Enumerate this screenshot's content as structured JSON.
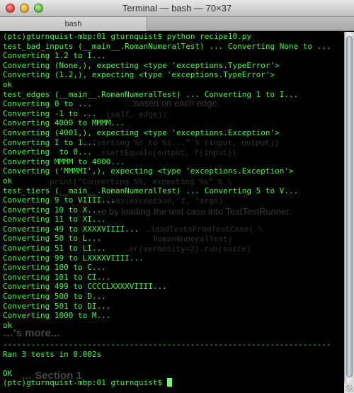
{
  "window": {
    "title": "Terminal — bash — 70×37",
    "tab_label": "bash"
  },
  "ghost_text": {
    "a": "…based on each edge.",
    "b": "(self, edge):",
    "c": "\"verting %s to %s...\" % (input, output))",
    "d": "…ssertEquals(output, f(input))",
    "e": "print(\"Converting %s, expecting %s\" % \\",
    "f": "…ses(exception, f, *args)",
    "g": "…e by loading the test case into TextTestRunner.",
    "h": "…loadTestsFromTestCase( \\",
    "i": "RomanNumeralTest)",
    "j": "…er(verbosity=2).run(suite)",
    "k": "…'s more...",
    "l": "… Section 1"
  },
  "terminal": {
    "lines": [
      {
        "text": "(ptc)gturnquist-mbp:01 gturnquist$ python recipe10.py",
        "color": "green"
      },
      {
        "text": "test_bad_inputs (__main__.RomanNumeralTest) ... Converting None to ...",
        "color": "green"
      },
      {
        "text": "Converting 1.2 to I...",
        "color": "green"
      },
      {
        "text": "Converting (None,), expecting <type 'exceptions.TypeError'>",
        "color": "green"
      },
      {
        "text": "Converting (1.2,), expecting <type 'exceptions.TypeError'>",
        "color": "green"
      },
      {
        "text": "ok",
        "color": "green"
      },
      {
        "text": "test_edges (__main__.RomanNumeralTest) ... Converting 1 to I...",
        "color": "green"
      },
      {
        "text": "Converting 0 to ...",
        "color": "green"
      },
      {
        "text": "Converting -1 to ...",
        "color": "green"
      },
      {
        "text": "Converting 4000 to MMMM...",
        "color": "green"
      },
      {
        "text": "Converting (4001,), expecting <type 'exceptions.Exception'>",
        "color": "green"
      },
      {
        "text": "Converting I to 1...",
        "color": "green"
      },
      {
        "text": "Converting  to 0...",
        "color": "green"
      },
      {
        "text": "Converting MMMM to 4000...",
        "color": "green"
      },
      {
        "text": "Converting ('MMMMI',), expecting <type 'exceptions.Exception'>",
        "color": "green"
      },
      {
        "text": "ok",
        "color": "green"
      },
      {
        "text": "test_tiers (__main__.RomanNumeralTest) ... Converting 5 to V...",
        "color": "green"
      },
      {
        "text": "Converting 9 to VIIII...",
        "color": "green"
      },
      {
        "text": "Converting 10 to X...",
        "color": "green"
      },
      {
        "text": "Converting 11 to XI...",
        "color": "green"
      },
      {
        "text": "Converting 49 to XXXXVIIII...",
        "color": "green"
      },
      {
        "text": "Converting 50 to L...",
        "color": "green"
      },
      {
        "text": "Converting 51 to LI...",
        "color": "green"
      },
      {
        "text": "Converting 99 to LXXXXVIIII...",
        "color": "green"
      },
      {
        "text": "Converting 100 to C...",
        "color": "green"
      },
      {
        "text": "Converting 101 to CI...",
        "color": "green"
      },
      {
        "text": "Converting 499 to CCCCLXXXXVIIII...",
        "color": "green"
      },
      {
        "text": "Converting 500 to D...",
        "color": "green"
      },
      {
        "text": "Converting 501 to DI...",
        "color": "green"
      },
      {
        "text": "Converting 1000 to M...",
        "color": "green"
      },
      {
        "text": "ok",
        "color": "green"
      },
      {
        "text": "",
        "color": "green"
      },
      {
        "text": "----------------------------------------------------------------------",
        "color": "green"
      },
      {
        "text": "Ran 3 tests in 0.002s",
        "color": "green"
      },
      {
        "text": "",
        "color": "green"
      },
      {
        "text": "OK",
        "color": "green"
      },
      {
        "text": "(ptc)gturnquist-mbp:01 gturnquist$ ",
        "color": "green"
      }
    ]
  },
  "colors": {
    "terminal_bg": "#000000",
    "terminal_fg": "#33ff33"
  }
}
